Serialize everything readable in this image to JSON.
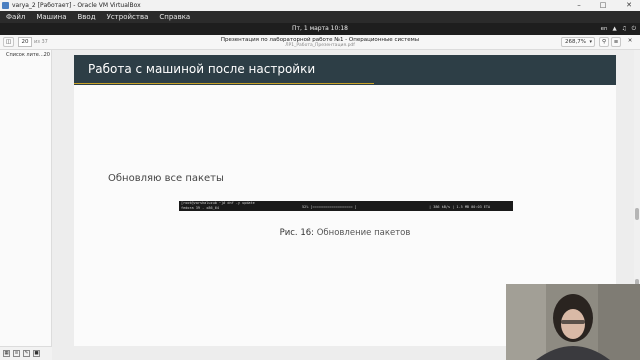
{
  "window": {
    "title": "varya_2 [Работает] - Oracle VM VirtualBox"
  },
  "vm_menu": [
    "Файл",
    "Машина",
    "Ввод",
    "Устройства",
    "Справка"
  ],
  "guest_bar": {
    "clock": "Пт, 1 марта 10:18",
    "layout": "en"
  },
  "viewer": {
    "page_current": "20",
    "page_total": "из 37",
    "doc_title": "Презентация по лабораторной работе №1 - Операционные системы",
    "doc_file": "ЛР1_Работа_Презентация.pdf",
    "zoom": "268,7%"
  },
  "sidebar": {
    "toc_label": "Список лите…",
    "toc_page": "20"
  },
  "slide": {
    "header": "Работа с машиной после настройки",
    "body": "Обновляю все пакеты",
    "terminal_line1": "[root@varshaluzub ~]# dnf -y update",
    "terminal_line2": "fedora 39 - x86_64",
    "terminal_progress": "52% [===================          ]",
    "terminal_stats": "| 386 kB/s |  1.5 MB     00:03 ETA",
    "caption_label": "Рис. 16:",
    "caption_text": " Обновление пакетов"
  },
  "colors": {
    "slide_header": "#2d3e46",
    "accent_line": "#c9a227",
    "vm_menu_bg": "#2b2b2b"
  }
}
